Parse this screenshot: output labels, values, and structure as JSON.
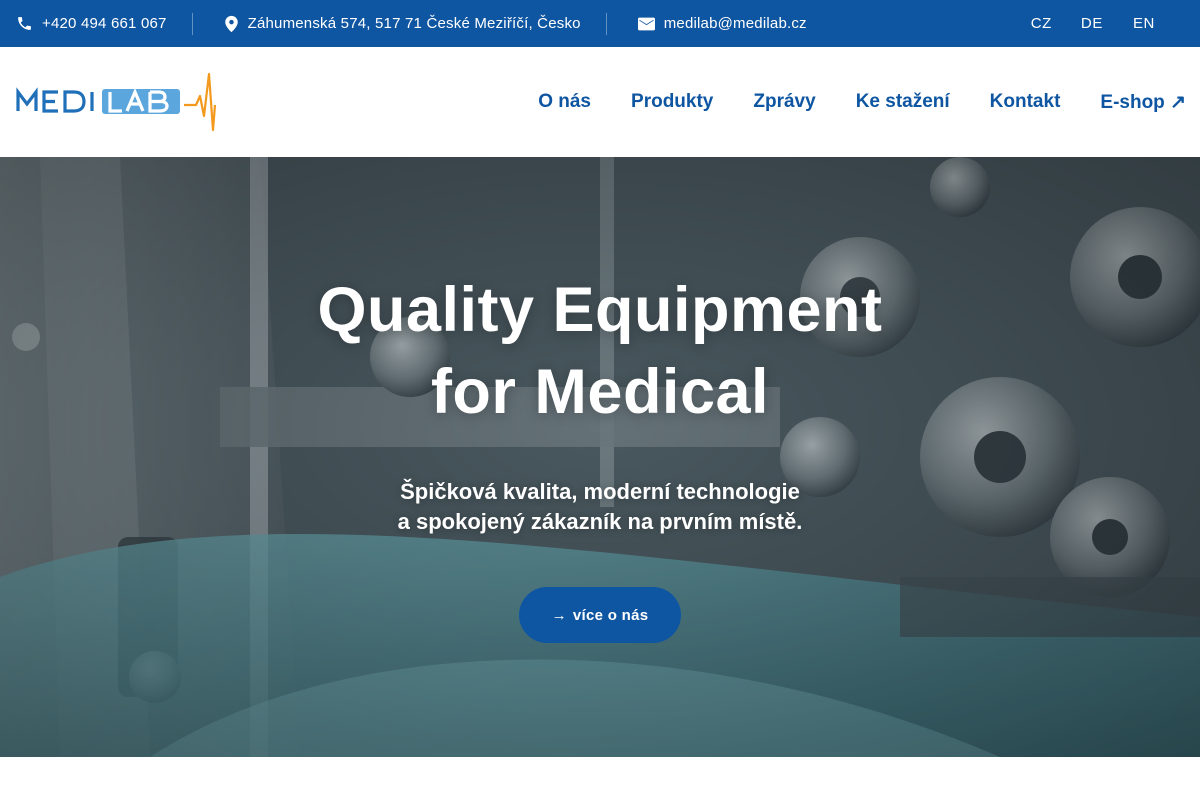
{
  "topbar": {
    "phone": "+420 494 661 067",
    "phone_icon": "phone-icon",
    "address": "Záhumenská 574, 517 71 České Meziříčí, Česko",
    "address_icon": "map-pin-icon",
    "email": "medilab@medilab.cz",
    "email_icon": "envelope-icon",
    "languages": [
      "CZ",
      "DE",
      "EN"
    ]
  },
  "header": {
    "logo_text": "MEDILAB",
    "nav": [
      "O nás",
      "Produkty",
      "Zprávy",
      "Ke stažení",
      "Kontakt",
      "E-shop ↗"
    ]
  },
  "hero": {
    "title_line1": "Quality Equipment",
    "title_line2": "for Medical",
    "subtitle_line1": "Špičková kvalita, moderní technologie",
    "subtitle_line2": "a spokojený zákazník na prvním místě.",
    "button_arrow": "→",
    "button_label": "více o nás"
  },
  "colors": {
    "brand_blue": "#0f56a2",
    "logo_light_blue": "#5ba6dd",
    "logo_orange": "#f39a1e"
  }
}
